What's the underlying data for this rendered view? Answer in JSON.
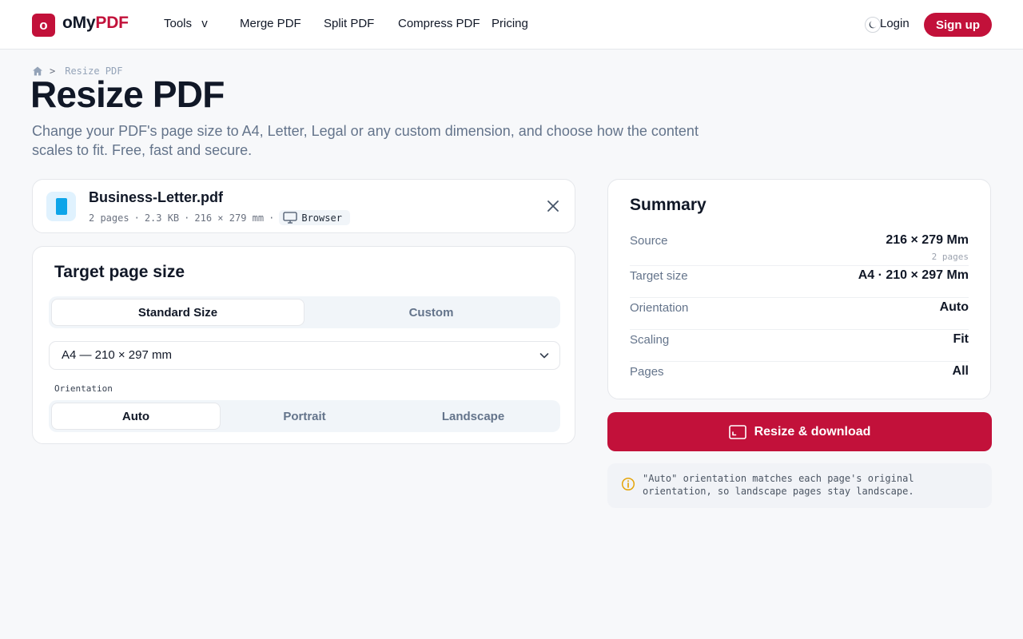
{
  "brand": {
    "logo_letter": "o",
    "name_prefix": "oMy",
    "name_accent": "PDF"
  },
  "nav": {
    "tools": "Tools",
    "tools_chevron": "v",
    "merge": "Merge PDF",
    "split": "Split PDF",
    "compress": "Compress PDF",
    "pricing": "Pricing",
    "theme_icon": "moon-icon",
    "login": "Login",
    "signup": "Sign up"
  },
  "breadcrumb": {
    "separator": ">",
    "current": "Resize PDF"
  },
  "hero": {
    "title": "Resize PDF",
    "subtitle": "Change your PDF's page size to A4, Letter, Legal or any custom dimension, and choose how the content scales to fit. Free, fast and secure."
  },
  "file": {
    "name": "Business-Letter.pdf",
    "pages": "2 pages",
    "size": "2.3 KB",
    "dimensions": "216 × 279 mm",
    "separator": "·",
    "badge": "Browser"
  },
  "target": {
    "title": "Target page size",
    "modes": [
      "Standard Size",
      "Custom"
    ],
    "active_mode": "Standard Size",
    "selected_size": "A4 — 210 × 297 mm",
    "orientation_label": "Orientation",
    "orientations": [
      "Auto",
      "Portrait",
      "Landscape"
    ],
    "active_orientation": "Auto"
  },
  "summary": {
    "title": "Summary",
    "rows": [
      {
        "label": "Source",
        "value": "216 × 279 Mm",
        "extra": "2 pages"
      },
      {
        "label": "Target size",
        "value": "A4 · 210 × 297 Mm"
      },
      {
        "label": "Orientation",
        "value": "Auto"
      },
      {
        "label": "Scaling",
        "value": "Fit"
      },
      {
        "label": "Pages",
        "value": "All"
      }
    ]
  },
  "action": {
    "label": "Resize & download"
  },
  "note": {
    "text": "\"Auto\" orientation matches each page's original orientation, so landscape pages stay landscape."
  },
  "colors": {
    "accent": "#c2113a",
    "file_icon": "#0ea5e9",
    "info": "#e5a50a"
  }
}
